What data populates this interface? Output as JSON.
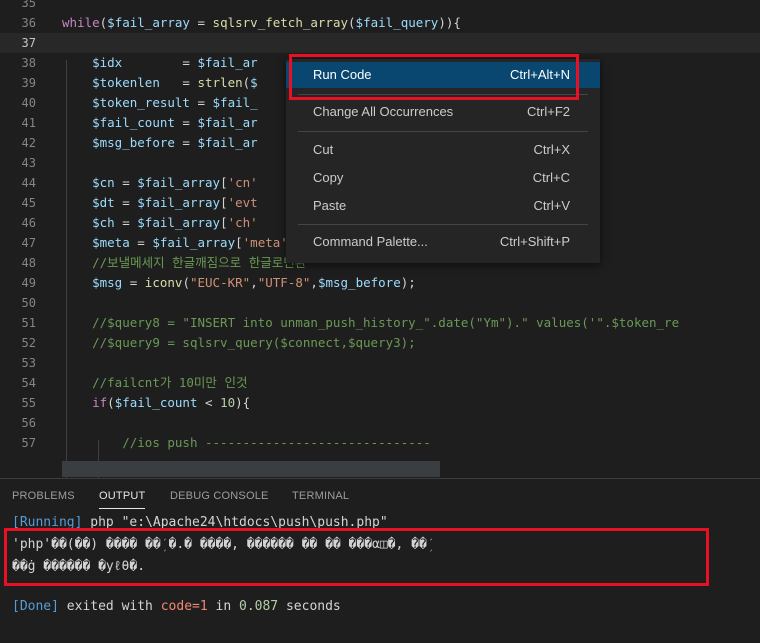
{
  "editor": {
    "lines": [
      {
        "n": "35",
        "code": ""
      },
      {
        "n": "36",
        "code": "while($fail_array = sqlsrv_fetch_array($fail_query)){"
      },
      {
        "n": "37",
        "code": ""
      },
      {
        "n": "38",
        "code": "    $idx        = $fail_ar"
      },
      {
        "n": "39",
        "code": "    $tokenlen   = strlen($"
      },
      {
        "n": "40",
        "code": "    $token_result = $fail_"
      },
      {
        "n": "41",
        "code": "    $fail_count = $fail_ar"
      },
      {
        "n": "42",
        "code": "    $msg_before = $fail_ar"
      },
      {
        "n": "43",
        "code": ""
      },
      {
        "n": "44",
        "code": "    $cn = $fail_array['cn'"
      },
      {
        "n": "45",
        "code": "    $dt = $fail_array['evt"
      },
      {
        "n": "46",
        "code": "    $ch = $fail_array['ch'"
      },
      {
        "n": "47",
        "code": "    $meta = $fail_array['meta'];"
      },
      {
        "n": "48",
        "code": "    //보낼메세지 한글깨짐으로 한글로변환"
      },
      {
        "n": "49",
        "code": "    $msg = iconv(\"EUC-KR\",\"UTF-8\",$msg_before);"
      },
      {
        "n": "50",
        "code": ""
      },
      {
        "n": "51",
        "code": "    //$query8 = \"INSERT into unman_push_history_\".date(\"Ym\").\" values('\".$token_re"
      },
      {
        "n": "52",
        "code": "    //$query9 = sqlsrv_query($connect,$query3);"
      },
      {
        "n": "53",
        "code": ""
      },
      {
        "n": "54",
        "code": "    //failcnt가 10미만 인것"
      },
      {
        "n": "55",
        "code": "    if($fail_count < 10){"
      },
      {
        "n": "56",
        "code": ""
      },
      {
        "n": "57",
        "code": "        //ios push ------------------------------"
      }
    ]
  },
  "context_menu": {
    "items": [
      {
        "label": "Run Code",
        "shortcut": "Ctrl+Alt+N"
      },
      {
        "label": "Change All Occurrences",
        "shortcut": "Ctrl+F2"
      },
      {
        "label": "Cut",
        "shortcut": "Ctrl+X"
      },
      {
        "label": "Copy",
        "shortcut": "Ctrl+C"
      },
      {
        "label": "Paste",
        "shortcut": "Ctrl+V"
      },
      {
        "label": "Command Palette...",
        "shortcut": "Ctrl+Shift+P"
      }
    ]
  },
  "panel": {
    "tabs": [
      "PROBLEMS",
      "OUTPUT",
      "DEBUG CONSOLE",
      "TERMINAL"
    ],
    "active_tab": "OUTPUT",
    "running_tag": "[Running]",
    "running_cmd": " php \"e:\\Apache24\\htdocs\\push\\push.php\"",
    "garbled_line1": "'php'��(��) ���� ��ܲ �.� ����, ������ �� �� ���α◫�, ��ܲ",
    "garbled_line2": "��ġ ������ �уℓθ�.",
    "done_tag": "[Done]",
    "done_text1": " exited with ",
    "done_code": "code=1",
    "done_text2": " in ",
    "done_time": "0.087",
    "done_text3": " seconds"
  },
  "colors": {
    "accent_highlight": "#094771",
    "callout_red": "#e81123"
  }
}
